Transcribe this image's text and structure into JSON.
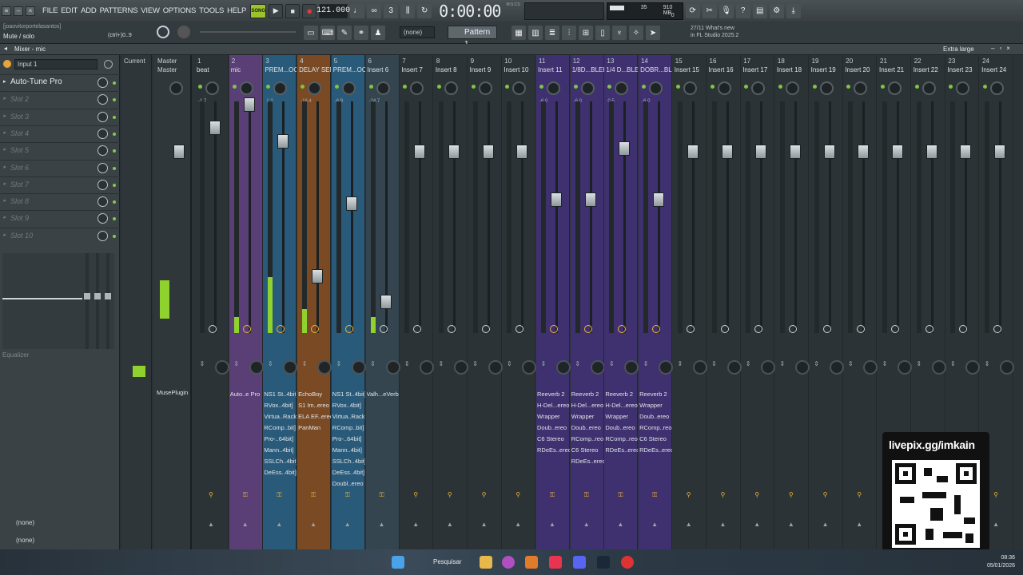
{
  "menu": [
    "FILE",
    "EDIT",
    "ADD",
    "PATTERNS",
    "VIEW",
    "OPTIONS",
    "TOOLS",
    "HELP"
  ],
  "transport": {
    "song_label": "SONG",
    "tempo": "121.000",
    "time": "0:00:00",
    "time_unit": "M:S:CS"
  },
  "cpu": {
    "val1": "35",
    "mem": "910 MB",
    "val2": "0"
  },
  "hint": {
    "user": "[joaovitorportelasantos]",
    "text": "Mute / solo",
    "shortcut": "(ctrl+)0..9"
  },
  "pattern": {
    "none": "(none)",
    "name": "Pattern 1"
  },
  "news": {
    "date": "27/11",
    "title": "What's new",
    "body": "in FL Studio 2025.2"
  },
  "mixer": {
    "title": "Mixer - mic",
    "size": "Extra large"
  },
  "input": "Input 1",
  "slots": [
    "Auto-Tune Pro",
    "Slot 2",
    "Slot 3",
    "Slot 4",
    "Slot 5",
    "Slot 6",
    "Slot 7",
    "Slot 8",
    "Slot 9",
    "Slot 10"
  ],
  "eq_label": "Equalizer",
  "routing": [
    "(none)",
    "(none)"
  ],
  "current_label": "Current",
  "master": {
    "num": "Master",
    "name": "Master",
    "fx": [
      "MusePlugin"
    ]
  },
  "tracks": [
    {
      "num": "1",
      "name": "beat",
      "val": "-1.7",
      "fader": 82,
      "meter": 0,
      "color": "",
      "fx": []
    },
    {
      "num": "2",
      "name": "mic",
      "val": "",
      "fader": 53,
      "meter": 20,
      "color": "#5a3f77",
      "fx": [
        "Auto..e Pro"
      ]
    },
    {
      "num": "3",
      "name": "PREM...OCAL",
      "val": "1.2",
      "fader": 99,
      "meter": 70,
      "color": "#2a5a7a",
      "fx": [
        "NS1 St..4bit]",
        "RVox..4bit]",
        "Virtua..Rack",
        "RComp..bit]",
        "Pro-..64bit]",
        "Mann..4bit]",
        "SSLCh..4bit]",
        "DeEss..4bit]"
      ]
    },
    {
      "num": "4",
      "name": "DELAY SEND",
      "val": "-18.4",
      "fader": 268,
      "meter": 30,
      "color": "#7a4a25",
      "fx": [
        "EchoBoy",
        "S1 Im..ereo",
        "ELA EF..ereo",
        "PanMan"
      ]
    },
    {
      "num": "5",
      "name": "PREM...OCAL",
      "val": "-6.9",
      "fader": 177,
      "meter": 0,
      "color": "#2a5a7a",
      "fx": [
        "NS1 St..4bit]",
        "RVox..4bit]",
        "Virtua..Rack",
        "RComp..bit]",
        "Pro-..64bit]",
        "Mann..4bit]",
        "SSLCh..4bit]",
        "DeEss..4bit]",
        "Doubl..ereo"
      ]
    },
    {
      "num": "6",
      "name": "Insert 6",
      "val": "-24.7",
      "fader": 300,
      "meter": 20,
      "color": "#34454f",
      "fx": [
        "Valh...eVerb"
      ]
    },
    {
      "num": "7",
      "name": "Insert 7",
      "val": "",
      "fader": 112,
      "meter": 0,
      "color": "",
      "fx": []
    },
    {
      "num": "8",
      "name": "Insert 8",
      "val": "",
      "fader": 112,
      "meter": 0,
      "color": "",
      "fx": []
    },
    {
      "num": "9",
      "name": "Insert 9",
      "val": "",
      "fader": 112,
      "meter": 0,
      "color": "",
      "fx": []
    },
    {
      "num": "10",
      "name": "Insert 10",
      "val": "",
      "fader": 112,
      "meter": 0,
      "color": "",
      "fx": []
    },
    {
      "num": "11",
      "name": "Insert 11",
      "val": "-6.0",
      "fader": 172,
      "meter": 0,
      "color": "#3f3070",
      "fx": [
        "Reeverb 2",
        "H-Del...ereo",
        "Wrapper",
        "Doub..ereo",
        "C6 Stereo",
        "RDeEs..ereo"
      ]
    },
    {
      "num": "12",
      "name": "1/8D...BLER",
      "val": "-6.0",
      "fader": 172,
      "meter": 0,
      "color": "#3f3070",
      "fx": [
        "Reeverb 2",
        "H-Del...ereo",
        "Wrapper",
        "Doub..ereo",
        "RComp..reo",
        "C6 Stereo",
        "RDeEs..ereo"
      ]
    },
    {
      "num": "13",
      "name": "1/4 D...BLER",
      "val": "0.5",
      "fader": 108,
      "meter": 0,
      "color": "#3f3070",
      "fx": [
        "Reeverb 2",
        "H-Del...ereo",
        "Wrapper",
        "Doub..ereo",
        "RComp..reo",
        "RDeEs..ereo"
      ]
    },
    {
      "num": "14",
      "name": "DOBR...BLER",
      "val": "-6.0",
      "fader": 172,
      "meter": 0,
      "color": "#3f3070",
      "fx": [
        "Reeverb 2",
        "Wrapper",
        "Doub..ereo",
        "RComp..reo",
        "C6 Stereo",
        "RDeEs..ereo"
      ]
    },
    {
      "num": "15",
      "name": "Insert 15",
      "val": "",
      "fader": 112,
      "meter": 0,
      "color": "",
      "fx": []
    },
    {
      "num": "16",
      "name": "Insert 16",
      "val": "",
      "fader": 112,
      "meter": 0,
      "color": "",
      "fx": []
    },
    {
      "num": "17",
      "name": "Insert 17",
      "val": "",
      "fader": 112,
      "meter": 0,
      "color": "",
      "fx": []
    },
    {
      "num": "18",
      "name": "Insert 18",
      "val": "",
      "fader": 112,
      "meter": 0,
      "color": "",
      "fx": []
    },
    {
      "num": "19",
      "name": "Insert 19",
      "val": "",
      "fader": 112,
      "meter": 0,
      "color": "",
      "fx": []
    },
    {
      "num": "20",
      "name": "Insert 20",
      "val": "",
      "fader": 112,
      "meter": 0,
      "color": "",
      "fx": []
    },
    {
      "num": "21",
      "name": "Insert 21",
      "val": "",
      "fader": 112,
      "meter": 0,
      "color": "",
      "fx": []
    },
    {
      "num": "22",
      "name": "Insert 22",
      "val": "",
      "fader": 112,
      "meter": 0,
      "color": "",
      "fx": []
    },
    {
      "num": "23",
      "name": "Insert 23",
      "val": "",
      "fader": 112,
      "meter": 0,
      "color": "",
      "fx": []
    },
    {
      "num": "24",
      "name": "Insert 24",
      "val": "",
      "fader": 112,
      "meter": 0,
      "color": "",
      "fx": []
    }
  ],
  "overlay": {
    "text": "livepix.gg/imkain"
  },
  "taskbar": {
    "search": "Pesquisar",
    "time": "08:36",
    "date": "05/01/2026"
  }
}
